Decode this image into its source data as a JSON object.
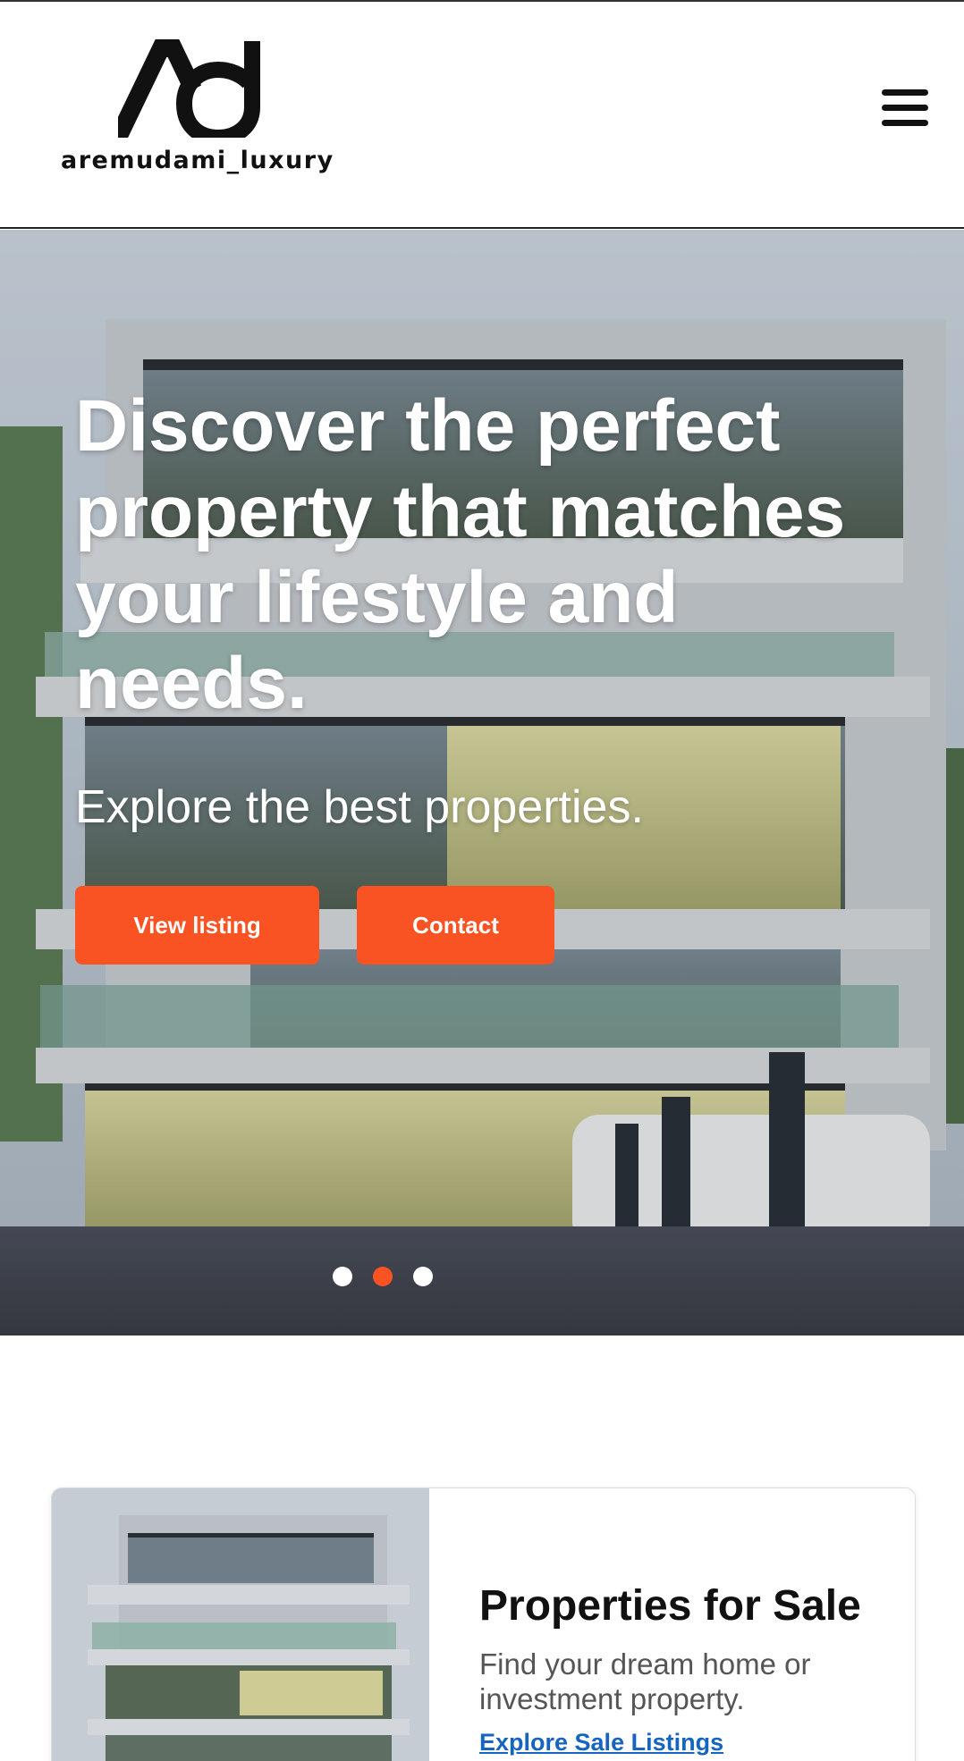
{
  "header": {
    "logo_text": "aremudami_luxury",
    "menu_icon": "hamburger-icon"
  },
  "hero": {
    "title": "Discover the perfect property that matches your lifestyle and needs.",
    "subtitle": "Explore the best properties.",
    "buttons": {
      "view_listing": "View listing",
      "contact": "Contact"
    },
    "carousel": {
      "slide_count": 3,
      "active_slide": 2
    }
  },
  "card": {
    "title": "Properties for Sale",
    "description": "Find your dream home or investment property.",
    "link": "Explore Sale Listings"
  },
  "colors": {
    "accent": "#fa5323",
    "link": "#1565c0",
    "text": "#111111"
  }
}
